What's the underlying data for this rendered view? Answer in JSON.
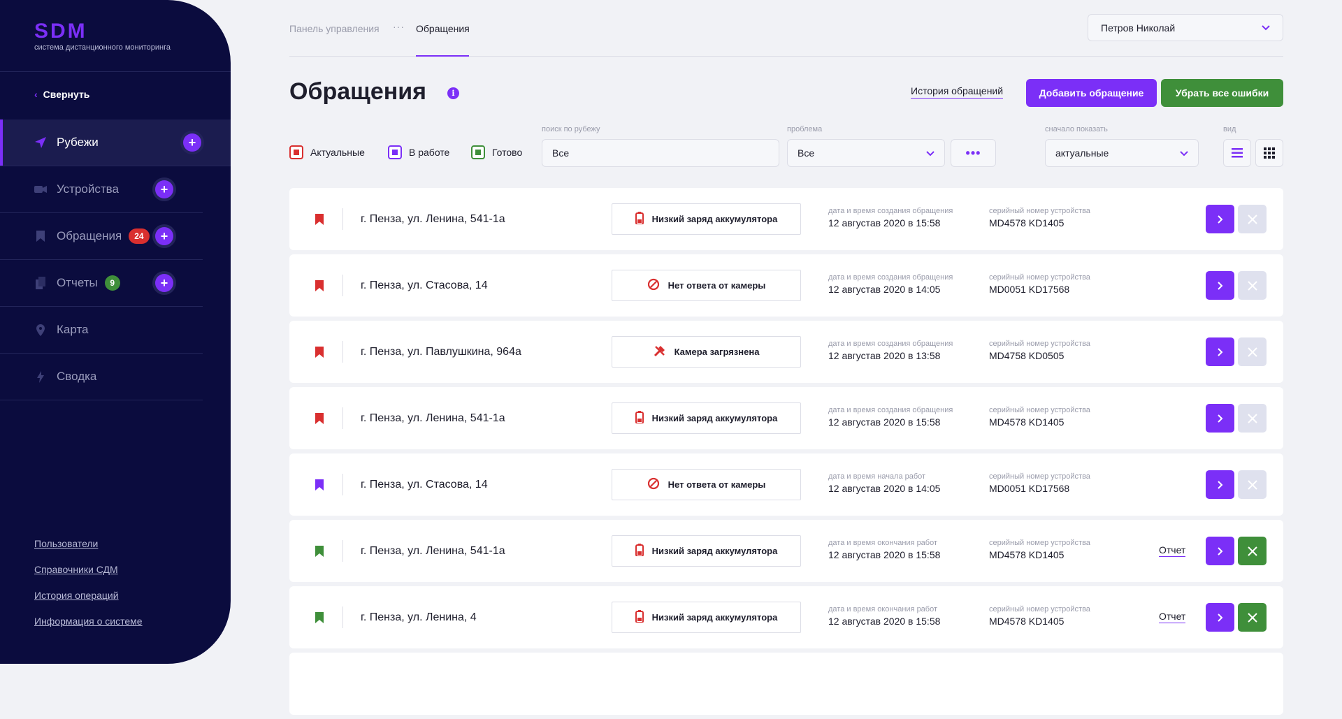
{
  "app": {
    "logo": "SDM",
    "subtitle": "система дистанционного мониторинга"
  },
  "sidebar": {
    "collapse_label": "Свернуть",
    "items": [
      {
        "label": "Рубежи",
        "icon": "send-icon",
        "badge": "",
        "plus": true,
        "active": true
      },
      {
        "label": "Устройства",
        "icon": "camera-icon",
        "badge": "",
        "plus": true
      },
      {
        "label": "Обращения",
        "icon": "bookmark-icon",
        "badge": "24",
        "plus": true
      },
      {
        "label": "Отчеты",
        "icon": "documents-icon",
        "badge": "9",
        "plus": true
      },
      {
        "label": "Карта",
        "icon": "map-pin-icon",
        "badge": "",
        "plus": false
      },
      {
        "label": "Сводка",
        "icon": "lightning-icon",
        "badge": "",
        "plus": false
      }
    ],
    "footer_links": [
      "Пользователи",
      "Справочники СДМ",
      "История операций",
      "Информация о системе"
    ]
  },
  "header": {
    "breadcrumb": [
      "Панель управления",
      "Обращения"
    ],
    "user": "Петров Николай"
  },
  "page": {
    "title": "Обращения",
    "history_link": "История обращений",
    "add_button": "Добавить обращение",
    "clear_button": "Убрать все ошибки"
  },
  "filters": {
    "statuses": [
      {
        "label": "Актуальные",
        "color": "#d92f2f"
      },
      {
        "label": "В работе",
        "color": "#7b2ff7"
      },
      {
        "label": "Готово",
        "color": "#3f8f3a"
      }
    ],
    "search_label": "поиск по рубежу",
    "search_value": "Все",
    "problem_label": "проблема",
    "problem_value": "Все",
    "show_first_label": "сначало показать",
    "show_first_value": "актуальные",
    "view_label": "вид"
  },
  "colors": {
    "accent": "#7b2ff7",
    "red": "#d92f2f",
    "green": "#3f8f3a",
    "sidebar": "#0b0c3e"
  },
  "rows": [
    {
      "status": "red",
      "address": "г. Пенза, ул. Ленина, 541-1а",
      "problem": "Низкий заряд аккумулятора",
      "problem_icon": "battery-icon",
      "date_label": "дата и время создания обращения",
      "date": "12 августав 2020 в 15:58",
      "serial_label": "серийный номер устройства",
      "serial": "MD4578 KD1405",
      "report": "",
      "closable": false
    },
    {
      "status": "red",
      "address": "г. Пенза, ул. Стасова, 14",
      "problem": "Нет ответа от камеры",
      "problem_icon": "no-signal-icon",
      "date_label": "дата и время создания обращения",
      "date": "12 августав 2020 в 14:05",
      "serial_label": "серийный номер устройства",
      "serial": "MD0051 KD17568",
      "report": "",
      "closable": false
    },
    {
      "status": "red",
      "address": "г. Пенза, ул. Павлушкина, 964а",
      "problem": "Камера загрязнена",
      "problem_icon": "tools-icon",
      "date_label": "дата и время создания обращения",
      "date": "12 августав 2020 в 13:58",
      "serial_label": "серийный номер устройства",
      "serial": "MD4758 KD0505",
      "report": "",
      "closable": false
    },
    {
      "status": "red",
      "address": "г. Пенза, ул. Ленина, 541-1а",
      "problem": "Низкий заряд аккумулятора",
      "problem_icon": "battery-icon",
      "date_label": "дата и время создания обращения",
      "date": "12 августав 2020 в 15:58",
      "serial_label": "серийный номер устройства",
      "serial": "MD4578 KD1405",
      "report": "",
      "closable": false
    },
    {
      "status": "purple",
      "address": "г. Пенза, ул. Стасова, 14",
      "problem": "Нет ответа от камеры",
      "problem_icon": "no-signal-icon",
      "date_label": "дата и время начала работ",
      "date": "12 августав 2020 в 14:05",
      "serial_label": "серийный номер устройства",
      "serial": "MD0051 KD17568",
      "report": "",
      "closable": false
    },
    {
      "status": "green",
      "address": "г. Пенза, ул. Ленина, 541-1а",
      "problem": "Низкий заряд аккумулятора",
      "problem_icon": "battery-icon",
      "date_label": "дата и время окончания работ",
      "date": "12 августав 2020 в 15:58",
      "serial_label": "серийный номер устройства",
      "serial": "MD4578 KD1405",
      "report": "Отчет",
      "closable": true
    },
    {
      "status": "green",
      "address": "г. Пенза, ул. Ленина, 4",
      "problem": "Низкий заряд аккумулятора",
      "problem_icon": "battery-icon",
      "date_label": "дата и время окончания работ",
      "date": "12 августав 2020 в 15:58",
      "serial_label": "серийный номер устройства",
      "serial": "MD4578 KD1405",
      "report": "Отчет",
      "closable": true
    }
  ]
}
